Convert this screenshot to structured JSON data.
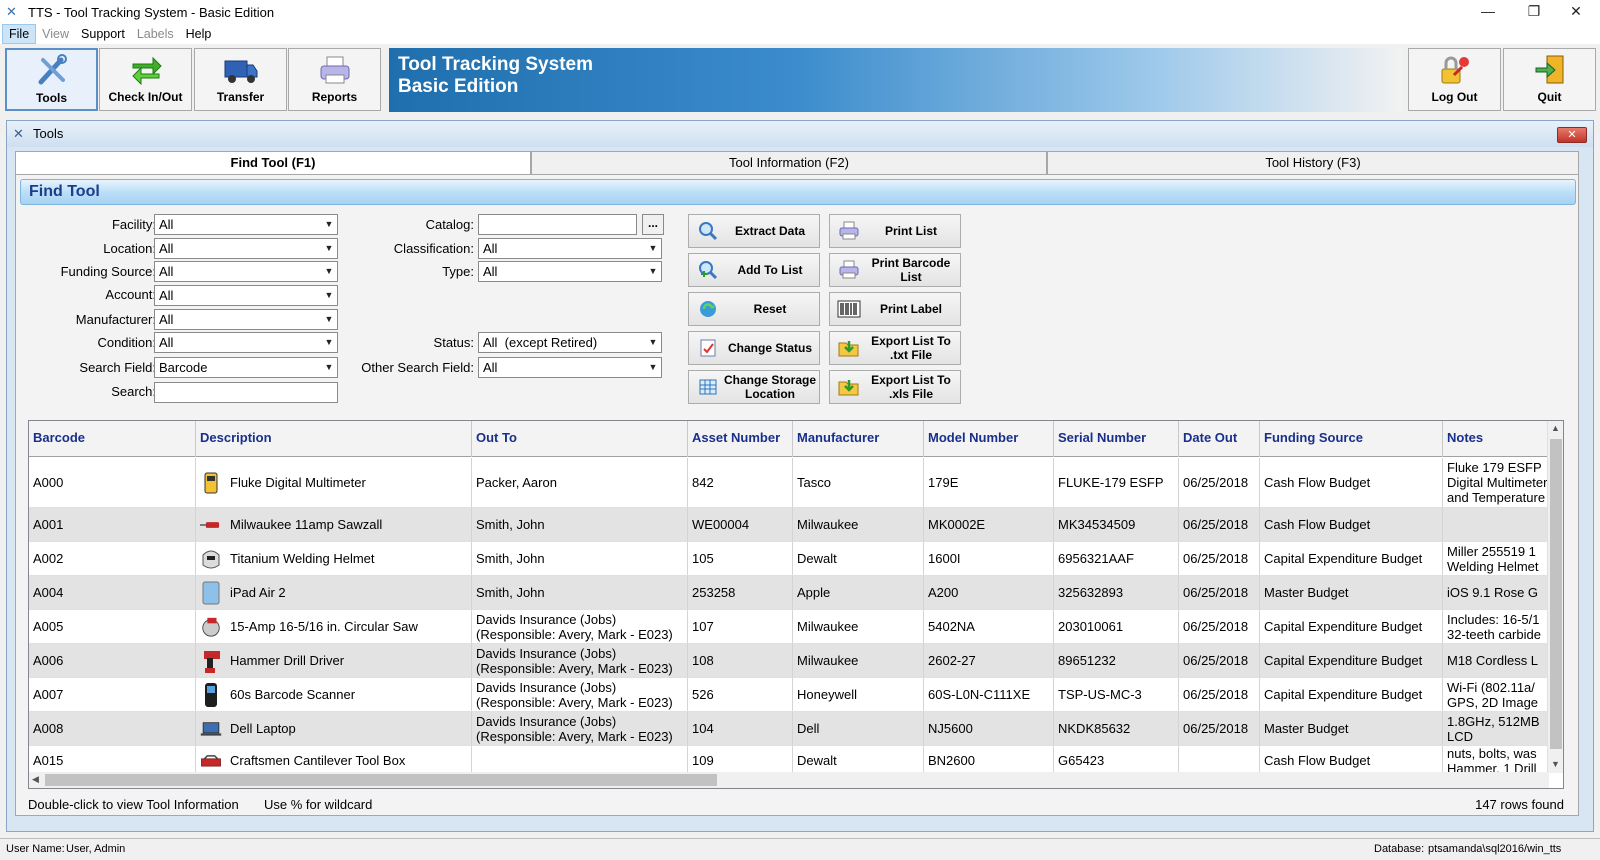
{
  "window": {
    "title": "TTS - Tool Tracking System - Basic Edition",
    "minimize": "—",
    "maximize": "❐",
    "close": "✕"
  },
  "menu": [
    "File",
    "View",
    "Support",
    "Labels",
    "Help"
  ],
  "toolbar": {
    "tools": "Tools",
    "checkinout": "Check In/Out",
    "transfer": "Transfer",
    "reports": "Reports",
    "logout": "Log Out",
    "quit": "Quit"
  },
  "banner": {
    "line1": "Tool Tracking System",
    "line2": "Basic Edition"
  },
  "tools_window": {
    "title": "Tools",
    "close": "✕"
  },
  "tabs": [
    "Find Tool (F1)",
    "Tool Information (F2)",
    "Tool History (F3)"
  ],
  "find_header": "Find Tool",
  "filters_left": [
    {
      "label": "Facility:",
      "value": "All"
    },
    {
      "label": "Location:",
      "value": "All"
    },
    {
      "label": "Funding Source:",
      "value": "All"
    },
    {
      "label": "Account:",
      "value": "All"
    },
    {
      "label": "Manufacturer:",
      "value": "All"
    },
    {
      "label": "Condition:",
      "value": "All"
    },
    {
      "label": "Search Field:",
      "value": "Barcode"
    },
    {
      "label": "Search:",
      "value": ""
    }
  ],
  "filters_mid": {
    "catalog_label": "Catalog:",
    "catalog_value": "",
    "catalog_btn": "...",
    "classification_label": "Classification:",
    "classification_value": "All",
    "type_label": "Type:",
    "type_value": "All",
    "status_label": "Status:",
    "status_value": "All  (except Retired)",
    "other_label": "Other Search Field:",
    "other_value": "All"
  },
  "actions": {
    "extract": "Extract Data",
    "add_to_list": "Add To List",
    "reset": "Reset",
    "change_status": "Change Status",
    "change_storage": "Change Storage Location",
    "print_list": "Print List",
    "print_barcode": "Print Barcode List",
    "print_label": "Print Label",
    "export_txt": "Export List To .txt File",
    "export_xls": "Export List To .xls File"
  },
  "grid": {
    "columns": [
      "Barcode",
      "Description",
      "Out To",
      "Asset Number",
      "Manufacturer",
      "Model Number",
      "Serial Number",
      "Date Out",
      "Funding Source",
      "Notes"
    ],
    "rows": [
      {
        "barcode": "A000",
        "icon": "multimeter-icon",
        "description": "Fluke Digital Multimeter",
        "out_to": "Packer, Aaron",
        "asset": "842",
        "manufacturer": "Tasco",
        "model": "179E",
        "serial": "FLUKE-179 ESFP",
        "date_out": "06/25/2018",
        "funding": "Cash Flow Budget",
        "notes": "Fluke 179 ESFP Digital Multimeter and Temperature"
      },
      {
        "barcode": "A001",
        "icon": "sawzall-icon",
        "description": "Milwaukee 11amp Sawzall",
        "out_to": "Smith, John",
        "asset": "WE00004",
        "manufacturer": "Milwaukee",
        "model": "MK0002E",
        "serial": "MK34534509",
        "date_out": "06/25/2018",
        "funding": "Cash Flow Budget",
        "notes": ""
      },
      {
        "barcode": "A002",
        "icon": "welding-helmet-icon",
        "description": "Titanium Welding Helmet",
        "out_to": "Smith, John",
        "asset": "105",
        "manufacturer": "Dewalt",
        "model": "1600I",
        "serial": "6956321AAF",
        "date_out": "06/25/2018",
        "funding": "Capital Expenditure Budget",
        "notes": "Miller 255519 1 Welding Helmet"
      },
      {
        "barcode": "A004",
        "icon": "tablet-icon",
        "description": "iPad Air 2",
        "out_to": "Smith, John",
        "asset": "253258",
        "manufacturer": "Apple",
        "model": "A200",
        "serial": "325632893",
        "date_out": "06/25/2018",
        "funding": "Master Budget",
        "notes": "iOS 9.1 Rose G"
      },
      {
        "barcode": "A005",
        "icon": "circular-saw-icon",
        "description": "15-Amp 16-5/16 in. Circular Saw",
        "out_to": "Davids Insurance (Jobs) (Responsible: Avery, Mark - E023)",
        "asset": "107",
        "manufacturer": "Milwaukee",
        "model": "5402NA",
        "serial": "203010061",
        "date_out": "06/25/2018",
        "funding": "Capital Expenditure Budget",
        "notes": "Includes: 16-5/1 32-teeth carbide"
      },
      {
        "barcode": "A006",
        "icon": "drill-icon",
        "description": "Hammer Drill Driver",
        "out_to": "Davids Insurance (Jobs) (Responsible: Avery, Mark - E023)",
        "asset": "108",
        "manufacturer": "Milwaukee",
        "model": "2602-27",
        "serial": "89651232",
        "date_out": "06/25/2018",
        "funding": "Capital Expenditure Budget",
        "notes": "M18 Cordless L"
      },
      {
        "barcode": "A007",
        "icon": "barcode-scanner-icon",
        "description": "60s Barcode Scanner",
        "out_to": "Davids Insurance (Jobs) (Responsible: Avery, Mark - E023)",
        "asset": "526",
        "manufacturer": "Honeywell",
        "model": "60S-L0N-C111XE",
        "serial": "TSP-US-MC-3",
        "date_out": "06/25/2018",
        "funding": "Capital Expenditure Budget",
        "notes": "Wi-Fi (802.11a/ GPS, 2D Image"
      },
      {
        "barcode": "A008",
        "icon": "laptop-icon",
        "description": "Dell Laptop",
        "out_to": "Davids Insurance (Jobs) (Responsible: Avery, Mark - E023)",
        "asset": "104",
        "manufacturer": "Dell",
        "model": "NJ5600",
        "serial": "NKDK85632",
        "date_out": "06/25/2018",
        "funding": "Master Budget",
        "notes": "1.8GHz, 512MB LCD"
      },
      {
        "barcode": "A015",
        "icon": "toolbox-icon",
        "description": "Craftsmen Cantilever Tool Box",
        "out_to": "",
        "asset": "109",
        "manufacturer": "Dewalt",
        "model": "BN2600",
        "serial": "G65423",
        "date_out": "",
        "funding": "Cash Flow Budget",
        "notes": "nuts, bolts, was Hammer, 1 Drill"
      }
    ]
  },
  "hints": {
    "dblclick": "Double-click to view Tool Information",
    "wildcard": "Use % for wildcard",
    "rows_found": "147 rows found"
  },
  "status": {
    "user_label": "User Name:",
    "user": "User, Admin",
    "db_label": "Database:",
    "db": "ptsamanda\\sql2016/win_tts"
  }
}
